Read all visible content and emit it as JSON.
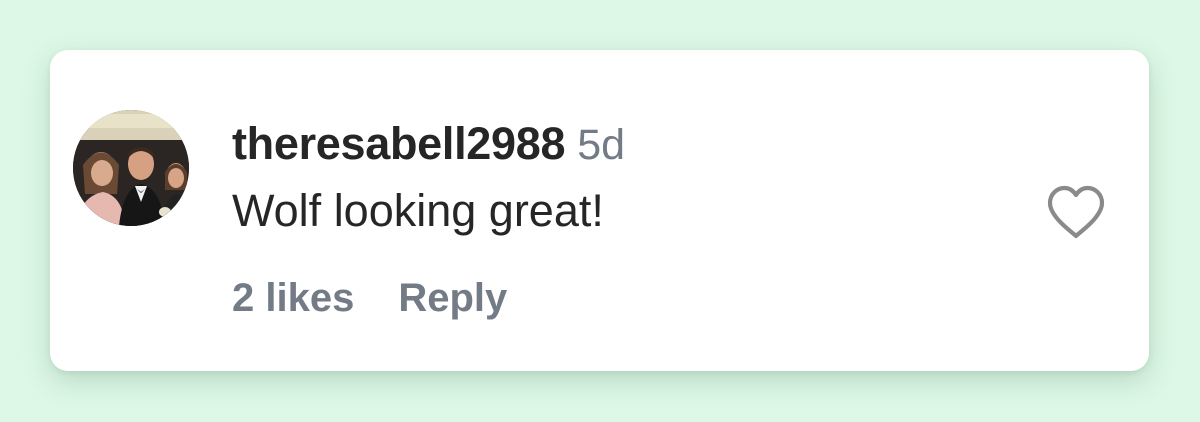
{
  "comment": {
    "username": "theresabell2988",
    "time_ago": "5d",
    "text": "Wolf looking great!",
    "likes_label": "2 likes",
    "reply_label": "Reply",
    "avatar_icon": "profile-photo-avatar",
    "like_icon": "heart-outline-icon"
  },
  "colors": {
    "background": "#ddf8e6",
    "card": "#ffffff",
    "primary_text": "#262626",
    "secondary_text": "#737b86",
    "icon": "#8a8a8a"
  }
}
